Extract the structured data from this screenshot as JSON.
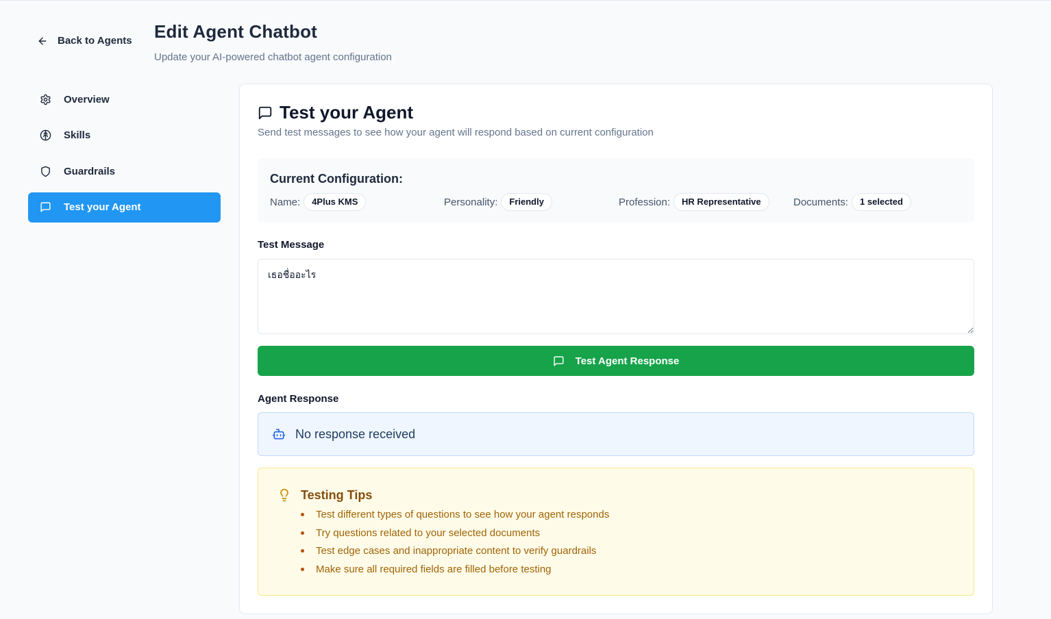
{
  "header": {
    "back_label": "Back to Agents",
    "title": "Edit Agent Chatbot",
    "subtitle": "Update your AI-powered chatbot agent configuration"
  },
  "sidebar": {
    "items": [
      {
        "label": "Overview",
        "icon": "gear-icon",
        "active": false
      },
      {
        "label": "Skills",
        "icon": "brain-icon",
        "active": false
      },
      {
        "label": "Guardrails",
        "icon": "shield-icon",
        "active": false
      },
      {
        "label": "Test your Agent",
        "icon": "message-icon",
        "active": true
      }
    ]
  },
  "test_panel": {
    "title": "Test your Agent",
    "description": "Send test messages to see how your agent will respond based on current configuration",
    "config": {
      "heading": "Current Configuration:",
      "name_label": "Name:",
      "name_value": "4Plus KMS",
      "personality_label": "Personality:",
      "personality_value": "Friendly",
      "profession_label": "Profession:",
      "profession_value": "HR Representative",
      "documents_label": "Documents:",
      "documents_value": "1 selected"
    },
    "message_label": "Test Message",
    "message_value": "เธอชื่ออะไร",
    "test_button_label": "Test Agent Response",
    "response_label": "Agent Response",
    "response_text": "No response received",
    "tips": {
      "title": "Testing Tips",
      "items": [
        "Test different types of questions to see how your agent responds",
        "Try questions related to your selected documents",
        "Test edge cases and inappropriate content to verify guardrails",
        "Make sure all required fields are filled before testing"
      ]
    }
  },
  "colors": {
    "accent": "#2196f3",
    "primary_button": "#16a34a",
    "response_bg": "#eff6ff",
    "tips_bg": "#fefce8",
    "tips_text": "#a16207"
  }
}
